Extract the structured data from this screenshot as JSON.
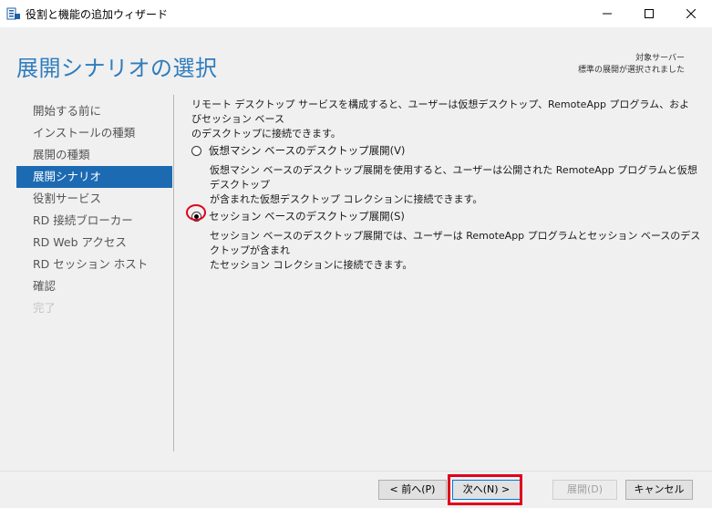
{
  "window": {
    "title": "役割と機能の追加ウィザード",
    "icon": "server-manager-icon"
  },
  "header": {
    "page_title": "展開シナリオの選択",
    "target_label": "対象サーバー",
    "target_value": "標準の展開が選択されました"
  },
  "nav": {
    "items": [
      {
        "label": "開始する前に",
        "state": "normal"
      },
      {
        "label": "インストールの種類",
        "state": "normal"
      },
      {
        "label": "展開の種類",
        "state": "normal"
      },
      {
        "label": "展開シナリオ",
        "state": "active"
      },
      {
        "label": "役割サービス",
        "state": "normal"
      },
      {
        "label": "RD 接続ブローカー",
        "state": "normal"
      },
      {
        "label": "RD Web アクセス",
        "state": "normal"
      },
      {
        "label": "RD セッション ホスト",
        "state": "normal"
      },
      {
        "label": "確認",
        "state": "normal"
      },
      {
        "label": "完了",
        "state": "disabled"
      }
    ]
  },
  "content": {
    "intro_line1": "リモート デスクトップ サービスを構成すると、ユーザーは仮想デスクトップ、RemoteApp プログラム、およびセッション ベース",
    "intro_line2": "のデスクトップに接続できます。",
    "options": [
      {
        "label": "仮想マシン ベースのデスクトップ展開(V)",
        "checked": false,
        "desc_line1": "仮想マシン ベースのデスクトップ展開を使用すると、ユーザーは公開された RemoteApp プログラムと仮想デスクトップ",
        "desc_line2": "が含まれた仮想デスクトップ コレクションに接続できます。"
      },
      {
        "label": "セッション ベースのデスクトップ展開(S)",
        "checked": true,
        "desc_line1": "セッション ベースのデスクトップ展開では、ユーザーは RemoteApp プログラムとセッション ベースのデスクトップが含まれ",
        "desc_line2": "たセッション コレクションに接続できます。"
      }
    ]
  },
  "footer": {
    "prev_label": "< 前へ(P)",
    "next_label": "次へ(N) >",
    "deploy_label": "展開(D)",
    "cancel_label": "キャンセル"
  },
  "colors": {
    "accent": "#1c6ab2",
    "title_blue": "#2f7cbd",
    "highlight_red": "#e0001b"
  }
}
